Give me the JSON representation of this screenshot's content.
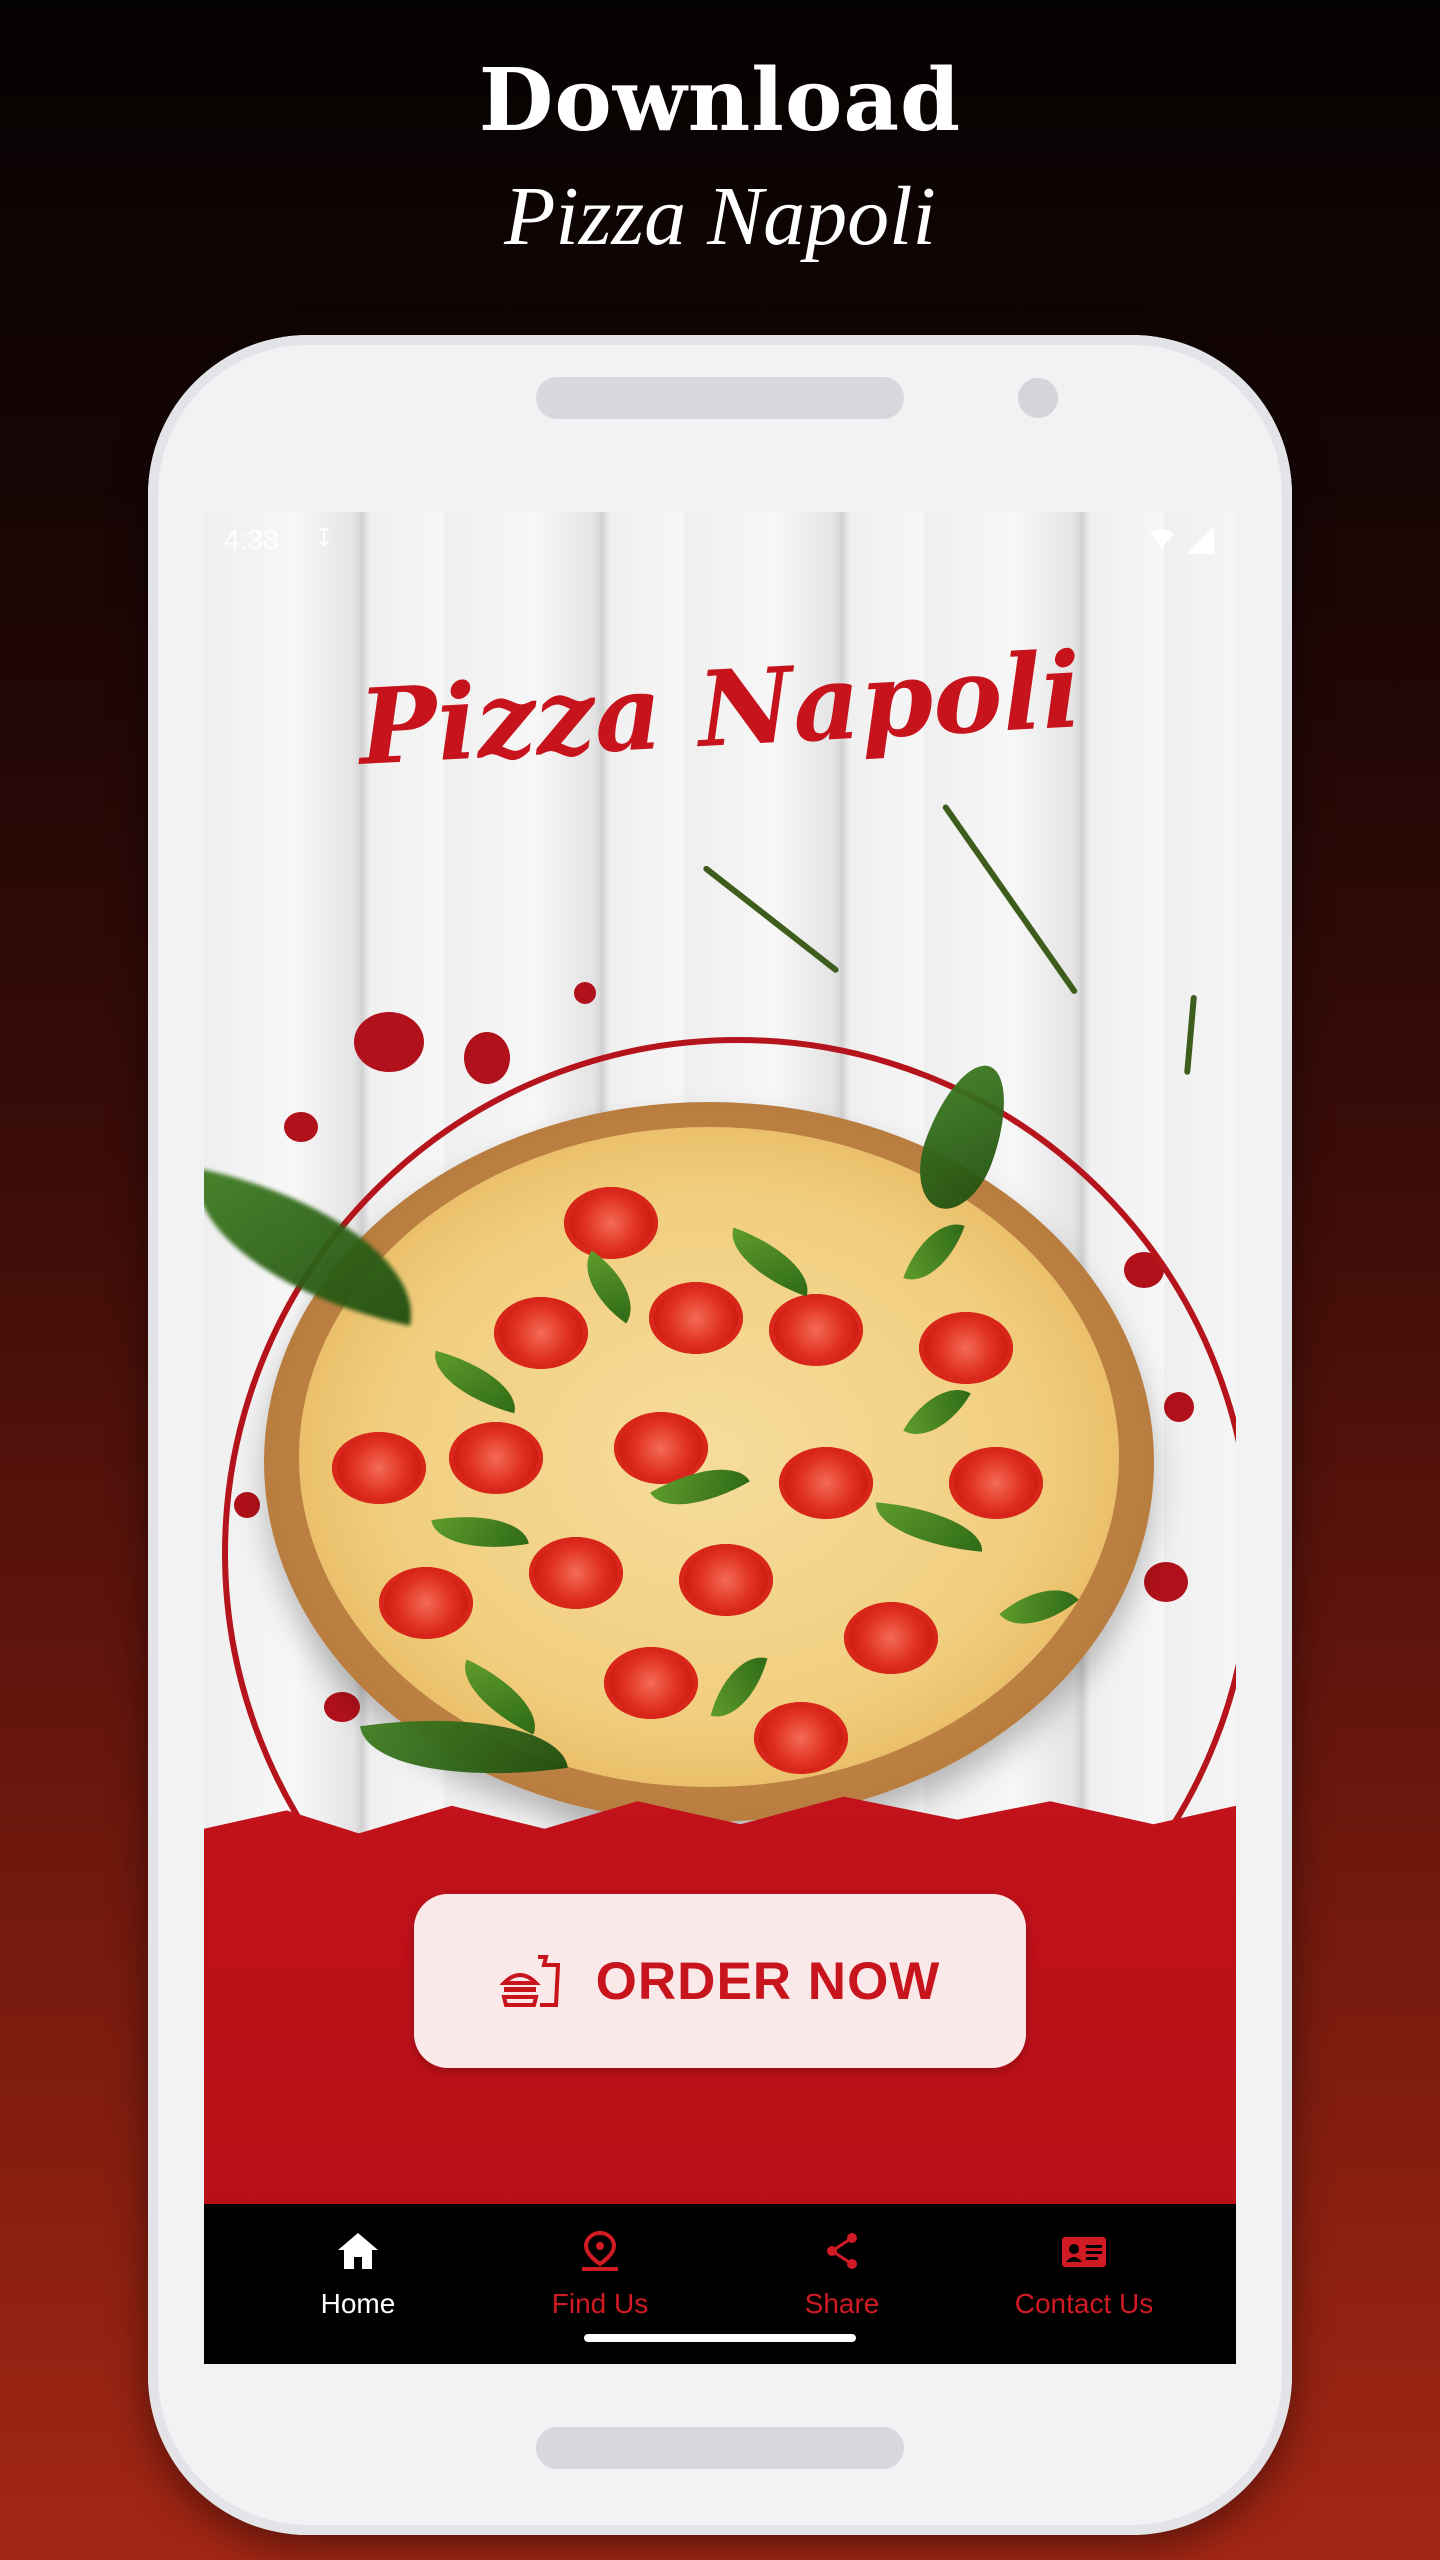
{
  "promo": {
    "line1": "Download",
    "line2": "Pizza Napoli"
  },
  "status_bar": {
    "time": "4:38"
  },
  "screen": {
    "brand_title": "Pizza Napoli",
    "order_button_label": "ORDER NOW"
  },
  "bottom_nav": {
    "items": [
      {
        "label": "Home",
        "icon": "home-icon",
        "active": true
      },
      {
        "label": "Find Us",
        "icon": "location-pin-icon",
        "active": false
      },
      {
        "label": "Share",
        "icon": "share-icon",
        "active": false
      },
      {
        "label": "Contact Us",
        "icon": "contact-card-icon",
        "active": false
      }
    ]
  },
  "colors": {
    "brand_red": "#c8141c",
    "button_bg": "#fbe9ea",
    "nav_bg": "#000000"
  }
}
